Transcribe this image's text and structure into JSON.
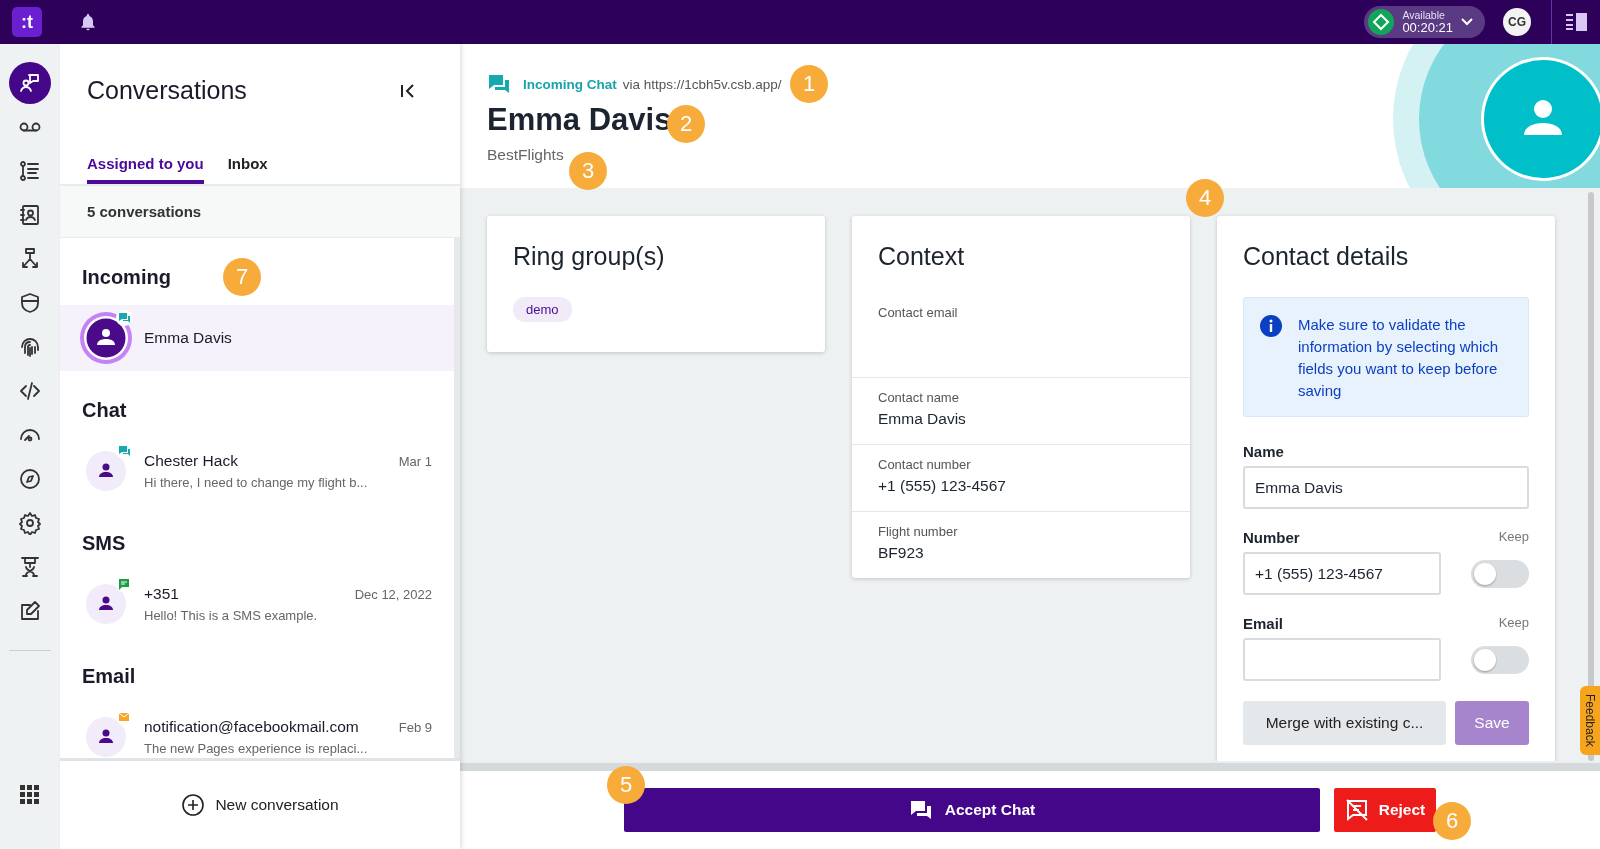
{
  "topbar": {
    "logo": ":t",
    "status": {
      "label": "Available",
      "timer": "00:20:21"
    },
    "user_initials": "CG"
  },
  "nav": [
    {
      "selected": true
    },
    {
      "selected": false
    },
    {
      "selected": false
    },
    {
      "selected": false
    },
    {
      "selected": false
    },
    {
      "selected": false
    },
    {
      "selected": false
    },
    {
      "selected": false
    },
    {
      "selected": false
    },
    {
      "selected": false
    },
    {
      "selected": false
    },
    {
      "selected": false
    },
    {
      "selected": false
    }
  ],
  "conversations": {
    "title": "Conversations",
    "tabs": [
      {
        "label": "Assigned to you",
        "selected": true
      },
      {
        "label": "Inbox",
        "selected": false
      }
    ],
    "count": "5 conversations",
    "sections": [
      {
        "title": "Incoming",
        "items": [
          {
            "name": "Emma Davis",
            "kind": "chat",
            "incoming": true,
            "selected": true
          }
        ]
      },
      {
        "title": "Chat",
        "items": [
          {
            "name": "Chester Hack",
            "date": "Mar 1",
            "preview": "Hi there, I need to change my flight b...",
            "kind": "chat",
            "incoming": false,
            "selected": false
          }
        ]
      },
      {
        "title": "SMS",
        "items": [
          {
            "name": "+351",
            "date": "Dec 12, 2022",
            "preview": "Hello! This is a SMS example.",
            "kind": "sms",
            "incoming": false,
            "selected": false
          }
        ]
      },
      {
        "title": "Email",
        "items": [
          {
            "name": "notification@facebookmail.com",
            "date": "Feb 9",
            "preview": "The new Pages experience is replaci...",
            "kind": "email",
            "incoming": false,
            "selected": false
          }
        ]
      }
    ],
    "new_button": "New conversation"
  },
  "header": {
    "channel": "Incoming Chat",
    "via": "via https://1cbh5v.csb.app/",
    "name": "Emma Davis",
    "company": "BestFlights"
  },
  "ring_groups": {
    "title": "Ring group(s)",
    "tags": [
      "demo"
    ]
  },
  "context": {
    "title": "Context",
    "rows": [
      {
        "label": "Contact email"
      },
      {
        "label": "Contact name",
        "value": "Emma Davis"
      },
      {
        "label": "Contact number",
        "value": "+1 (555) 123-4567"
      },
      {
        "label": "Flight number",
        "value": "BF923"
      }
    ]
  },
  "contact_details": {
    "title": "Contact details",
    "info": "Make sure to validate the information by selecting which fields you want to keep before saving",
    "fields": [
      {
        "label": "Name",
        "value": "Emma Davis",
        "kind": "plain"
      },
      {
        "label": "Number",
        "value": "+1 (555) 123-4567",
        "kind": "keep",
        "keep_label": "Keep",
        "on": false
      },
      {
        "label": "Email",
        "kind": "keep",
        "keep_label": "Keep",
        "on": false
      }
    ],
    "merge_button": "Merge with existing c...",
    "save_button": {
      "label": "Save",
      "disabled": true
    }
  },
  "actions": {
    "accept": "Accept Chat",
    "reject": "Reject"
  },
  "feedback": "Feedback",
  "callouts": [
    "1",
    "2",
    "3",
    "4",
    "5",
    "6",
    "7"
  ]
}
